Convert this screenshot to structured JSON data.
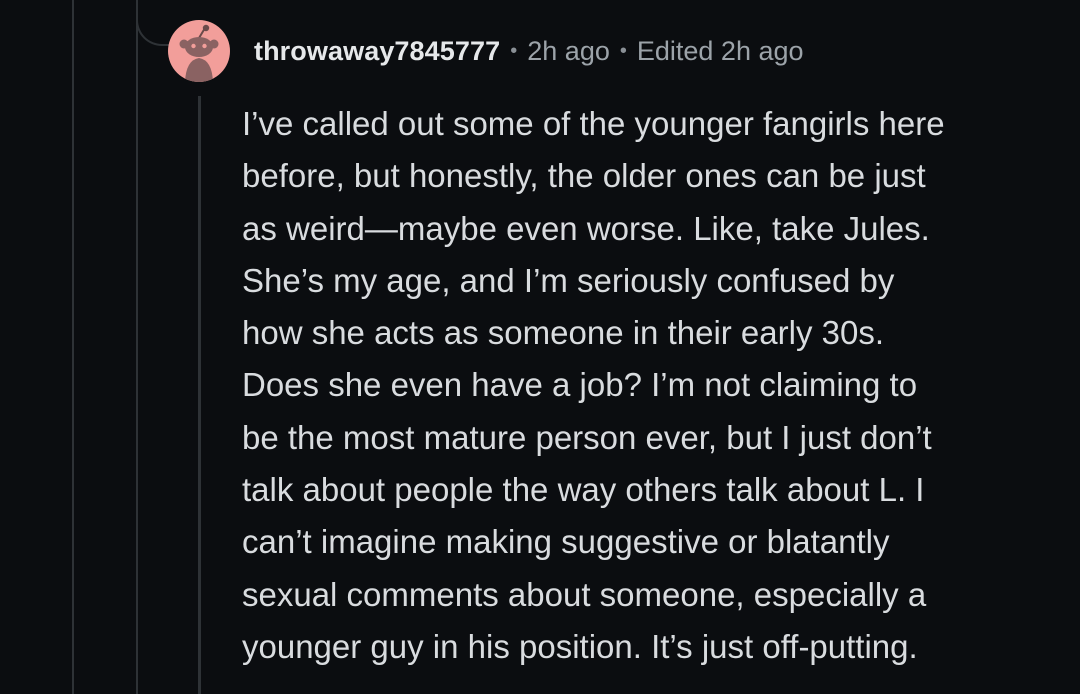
{
  "comment": {
    "username": "throwaway7845777",
    "separator": "•",
    "time": "2h ago",
    "edited": "Edited 2h ago",
    "avatar_icon": "snoo-avatar-icon",
    "avatar_color": "#f29e9a",
    "body_lines": [
      "I’ve called out some of the younger fangirls here",
      "before, but honestly, the older ones can be just",
      "as weird—maybe even worse. Like, take Jules.",
      "She’s my age, and I’m seriously confused by",
      "how she acts as someone in their early 30s.",
      "Does she even have a job? I’m not claiming to",
      "be the most mature person ever, but I just don’t",
      "talk about people the way others talk about L. I",
      "can’t imagine making suggestive or blatantly",
      "sexual comments about someone, especially a",
      "younger guy in his position. It’s just off-putting."
    ]
  }
}
